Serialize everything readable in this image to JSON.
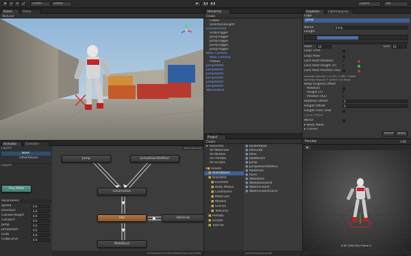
{
  "toolbar": {
    "tools": [
      "✥",
      "↔",
      "⟳",
      "⤢"
    ],
    "pivot": "Center",
    "space": "Global",
    "play_icons": [
      "▶",
      "❚❚",
      "▶❚"
    ],
    "layers": "Layers",
    "layout": "Tall"
  },
  "scene": {
    "tabs": [
      "Scene",
      "Hierarchy"
    ],
    "game_tab": "Game",
    "shading": "Textured",
    "create": "Create"
  },
  "hierarchy": {
    "tab": "Hierarchy",
    "create": "Create",
    "items": [
      {
        "label": "Cubes",
        "indent": 1,
        "blue": false
      },
      {
        "label": "DirectionalLight",
        "indent": 1,
        "blue": false
      },
      {
        "label": "Environment",
        "indent": 0,
        "blue": true
      },
      {
        "label": "GrabTrigger",
        "indent": 1,
        "blue": false
      },
      {
        "label": "JumpTrigger",
        "indent": 1,
        "blue": false
      },
      {
        "label": "JumpTrigger",
        "indent": 1,
        "blue": false
      },
      {
        "label": "JumpTrigger",
        "indent": 1,
        "blue": false
      },
      {
        "label": "JumpTrigger",
        "indent": 1,
        "blue": false
      },
      {
        "label": "Main Camera",
        "indent": 0,
        "blue": true
      },
      {
        "label": "Main Camera",
        "indent": 1,
        "blue": true
      },
      {
        "label": "Probes",
        "indent": 1,
        "blue": false
      },
      {
        "label": "Jump4Both",
        "indent": 0,
        "blue": true
      },
      {
        "label": "Jump4Both",
        "indent": 0,
        "blue": true
      },
      {
        "label": "Jump4Both",
        "indent": 0,
        "blue": true
      },
      {
        "label": "Jump4Both",
        "indent": 0,
        "blue": true
      },
      {
        "label": "Jump4Both",
        "indent": 0,
        "blue": true
      },
      {
        "label": "Jump4Both",
        "indent": 0,
        "blue": true
      },
      {
        "label": "WeaveBoss",
        "indent": 0,
        "blue": true
      }
    ]
  },
  "inspector": {
    "tabs": [
      "Inspector",
      "Lightmapping"
    ],
    "section": "Clips",
    "clip": "Jump",
    "name_label": "Name",
    "name_value": "Jump",
    "length_label": "Length",
    "loop_label": "Loop Time",
    "start_label": "Start",
    "start_value": "14",
    "end_label": "End",
    "end_value": "61",
    "loop_pose": "Loop Pose",
    "lock_rotation": "Lock Root Rotation",
    "lock_height": "Lock Root Height (Y)",
    "lock_position": "Lock Root Position (XZ)",
    "avg_velocity": "Average velocity: (-0.434, 0.282, 2.986)",
    "avg_angular": "Average Angular Y speed: 0.0 deg/s",
    "keep_original": "Keep Original Offset",
    "rotation_label": "Rotation",
    "height_label": "Height (Y)",
    "position_label": "Position (XZ)",
    "rotation_offset": "Rotation Offset",
    "rotation_offset_value": "0",
    "height_offset": "Height Offset",
    "height_offset_value": "0",
    "height_from_feet": "Height From Feet",
    "cycle_offset": "Cycle Offset",
    "mirror": "Mirror",
    "body_mask": "▸ Body Mask",
    "curves": "▸ Curves",
    "revert": "Revert",
    "apply": "Apply",
    "status_colors": [
      "#d32f2f",
      "#3fbf3f",
      "#d32f2f"
    ]
  },
  "preview": {
    "label": "Preview",
    "time": "0:00 (000.0%) Frame 0",
    "play": "▶",
    "speed": "1.00"
  },
  "project": {
    "tab": "Project",
    "create": "Create",
    "favorites": "Favorites",
    "fav_items": [
      "All Materials",
      "All Models",
      "All Prefabs",
      "All Scripts"
    ],
    "assets": "Assets",
    "tree": [
      {
        "label": "Animations",
        "indent": 1,
        "selected": true
      },
      {
        "label": "Animator",
        "indent": 1,
        "selected": false
      },
      {
        "label": "Finished",
        "indent": 2,
        "selected": false
      },
      {
        "label": "Body Masks",
        "indent": 2,
        "selected": false
      },
      {
        "label": "Controllers",
        "indent": 2,
        "selected": false
      },
      {
        "label": "Materials",
        "indent": 2,
        "selected": false
      },
      {
        "label": "Models",
        "indent": 2,
        "selected": false
      },
      {
        "label": "Scenes",
        "indent": 2,
        "selected": false
      },
      {
        "label": "Textures",
        "indent": 2,
        "selected": false
      },
      {
        "label": "Prefabs",
        "indent": 1,
        "selected": false
      },
      {
        "label": "Scripts",
        "indent": 1,
        "selected": false
      },
      {
        "label": "Tutorial",
        "indent": 1,
        "selected": false
      }
    ],
    "files": [
      "DudeRobot",
      "IdleGrab",
      "Idles",
      "IdleMoves",
      "Jump",
      "JumpDownRollRun",
      "Materials",
      "Runs",
      "WalkBack",
      "WalkBackward",
      "WalkForward",
      "WalkForwardTurns"
    ],
    "status": "Animations/Jump.fbx"
  },
  "animator": {
    "tabs": [
      "Animator",
      "Controller"
    ],
    "layers_label": "Base",
    "second_layer": "OtherMoves",
    "add_layer": "Layers",
    "params_header": "Parameters",
    "params": [
      {
        "name": "Speed",
        "value": "0.0"
      },
      {
        "name": "Direction",
        "value": "0.0"
      },
      {
        "name": "ColliderHeight",
        "value": "0.0"
      },
      {
        "name": "ColliderY",
        "value": "0.0"
      },
      {
        "name": "Jump",
        "value": "0.0"
      },
      {
        "name": "JumpDown",
        "value": "0.0"
      },
      {
        "name": "Grab",
        "value": "0.0"
      },
      {
        "name": "GrabCurve",
        "value": "0.0"
      }
    ],
    "nodes": {
      "jump": "Jump",
      "jumpdown": "JumpDownRollRun",
      "any": "Any State",
      "locomotion": "Locomotion",
      "idle": "Idle",
      "idlegrab": "IdleGrab",
      "walkback": "WalkBack"
    },
    "auto_live": "Auto Live Link",
    "footer": "Animator/Controllers/BaseLayer.controller"
  }
}
